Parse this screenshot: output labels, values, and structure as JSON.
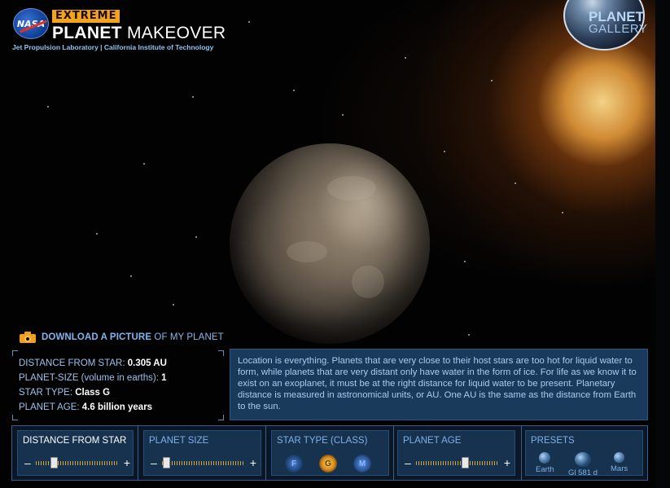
{
  "header": {
    "logo": "NASA",
    "badge": "EXTREME",
    "title_bold": "PLANET",
    "title_rest": "MAKEOVER",
    "subtitle": "Jet Propulsion Laboratory | California Institute of Technology"
  },
  "gallery": {
    "title": "PLANET",
    "subtitle": "GALLERY"
  },
  "download": {
    "bold": "DOWNLOAD A PICTURE",
    "rest": "OF MY PLANET"
  },
  "stats": {
    "distance_label": "DISTANCE FROM STAR:",
    "distance_value": "0.305 AU",
    "size_label": "PLANET-SIZE (volume in earths):",
    "size_value": "1",
    "star_label": "STAR TYPE:",
    "star_value": "Class G",
    "age_label": "PLANET AGE:",
    "age_value": "4.6 billion years"
  },
  "info": {
    "text": "Location is everything. Planets that are very close to their host stars are too hot for liquid water to form, while planets that are very distant only have water in the form of ice. For life as we know it to exist on an exoplanet, it must be at the right distance for liquid water to be present. Planetary distance is measured in astronomical units, or AU. One AU is the same as the distance from Earth to the sun."
  },
  "controls": {
    "distance": {
      "title": "DISTANCE FROM STAR",
      "minus": "–",
      "plus": "+",
      "level": 0.22
    },
    "size": {
      "title": "PLANET SIZE",
      "minus": "–",
      "plus": "+",
      "level": 0.05
    },
    "star_type": {
      "title": "STAR TYPE (CLASS)",
      "options": [
        "F",
        "G",
        "M"
      ],
      "selected": "G"
    },
    "age": {
      "title": "PLANET AGE",
      "minus": "–",
      "plus": "+",
      "level": 0.6
    },
    "presets": {
      "title": "PRESETS",
      "items": [
        "Earth",
        "Gl 581 d",
        "Mars"
      ]
    }
  },
  "colors": {
    "accent_orange": "#f2a51c",
    "panel_blue": "#17324f",
    "link_blue": "#7fb4ee"
  }
}
